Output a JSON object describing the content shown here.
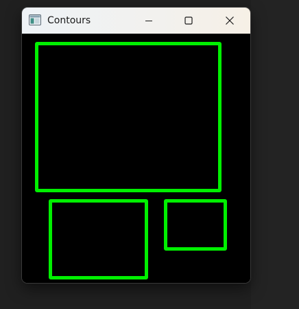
{
  "window": {
    "title": "Contours",
    "caption_buttons": {
      "minimize": "minimize-icon",
      "maximize": "maximize-icon",
      "close": "close-icon"
    }
  },
  "canvas": {
    "background_color": "#000000",
    "contour_color": "#00f000",
    "contours": [
      "large-rectangle",
      "bottom-left-rectangle",
      "bottom-right-rectangle"
    ]
  }
}
